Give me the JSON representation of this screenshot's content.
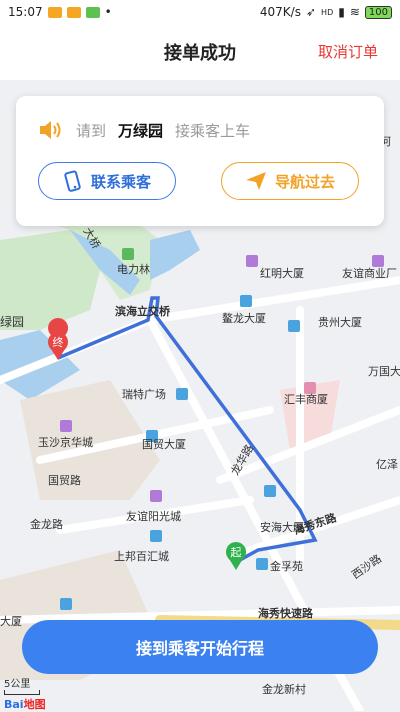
{
  "status_bar": {
    "time": "15:07",
    "network_speed": "407K/s",
    "battery": "100",
    "signal_label": "HD"
  },
  "header": {
    "title": "接单成功",
    "cancel_label": "取消订单"
  },
  "card": {
    "prefix": "请到",
    "destination": "万绿园",
    "suffix": "接乘客上车",
    "contact_label": "联系乘客",
    "navigate_label": "导航过去"
  },
  "map": {
    "labels": {
      "dianli": "电力林",
      "binhai": "滨海立交桥",
      "hongming": "红明大厦",
      "youyi_shangye": "友谊商业厂",
      "aolong": "鳌龙大厦",
      "guizhou": "贵州大厦",
      "wanlvyuan": "绿园",
      "wanguo": "万国大",
      "ruite": "瑞特广场",
      "huifeng": "汇丰商厦",
      "yusha": "玉沙京华城",
      "guomao": "国贸大厦",
      "guomao_road": "国贸路",
      "longhua_road": "龙华路",
      "yizhi": "亿泽",
      "jinlong_road": "金龙路",
      "youyi_yangguang": "友谊阳光城",
      "anhai": "安海大厦",
      "haixiu_east": "海秀东路",
      "shangbang": "上邦百汇城",
      "jinfuyuan": "金孚苑",
      "xisha_road": "西沙路",
      "haixiu_express": "海秀快速路",
      "jinlong_xincun": "金龙新村",
      "da_left": "大厦",
      "qiao": "大桥",
      "dingsha": "何",
      "start_marker": "起",
      "end_marker": "终"
    },
    "scale_label": "5公里",
    "logo_text": "Bai",
    "logo_text2": "地图"
  },
  "bottom": {
    "action_label": "接到乘客开始行程"
  },
  "colors": {
    "accent_blue": "#3b82f0",
    "cancel_red": "#e53935",
    "nav_orange": "#f2a227",
    "route": "#3f6fd8"
  }
}
